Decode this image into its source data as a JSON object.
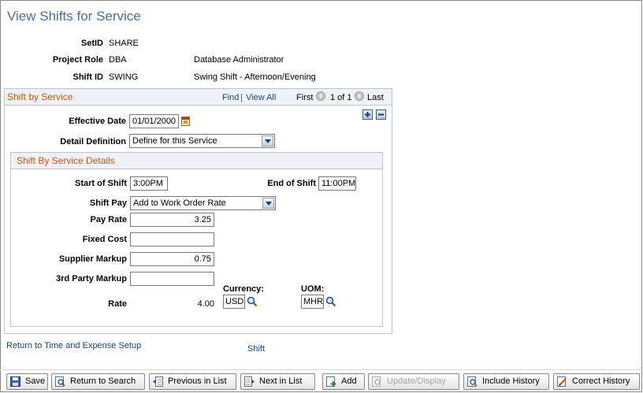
{
  "page": {
    "title": "View Shifts for Service"
  },
  "header": {
    "setid_label": "SetID",
    "setid_value": "SHARE",
    "role_label": "Project Role",
    "role_value": "DBA",
    "role_desc": "Database Administrator",
    "shift_label": "Shift ID",
    "shift_value": "SWING",
    "shift_desc": "Swing Shift - Afternoon/Evening"
  },
  "grid": {
    "title": "Shift by Service",
    "find": "Find",
    "sep": "|",
    "view_all": "View All",
    "first": "First",
    "range": "1 of 1",
    "last": "Last",
    "effective_date_label": "Effective Date",
    "effective_date": "01/01/2000",
    "detail_def_label": "Detail Definition",
    "detail_def_value": "Define for this Service"
  },
  "details": {
    "title": "Shift By Service Details",
    "start_label": "Start of Shift",
    "start_value": "3:00PM",
    "end_label": "End of Shift",
    "end_value": "11:00PM",
    "shift_pay_label": "Shift Pay",
    "shift_pay_value": "Add to Work Order Rate",
    "pay_rate_label": "Pay Rate",
    "pay_rate_value": "3.25",
    "fixed_cost_label": "Fixed Cost",
    "fixed_cost_value": "",
    "supplier_markup_label": "Supplier Markup",
    "supplier_markup_value": "0.75",
    "third_party_label": "3rd Party Markup",
    "third_party_value": "",
    "rate_label": "Rate",
    "rate_value": "4.00",
    "currency_label": "Currency:",
    "currency_value": "USD",
    "uom_label": "UOM:",
    "uom_value": "MHR"
  },
  "links": {
    "return_setup": "Return to Time and Expense Setup",
    "shift": "Shift"
  },
  "toolbar": {
    "save": "Save",
    "return_search": "Return to Search",
    "prev": "Previous in List",
    "next": "Next in List",
    "add": "Add",
    "update": "Update/Display",
    "include_history": "Include History",
    "correct_history": "Correct History"
  },
  "icons": {
    "calendar": "calendar-icon",
    "lookup": "magnifier-icon",
    "add_row": "plus-icon",
    "delete_row": "minus-icon",
    "prev": "left-arrow-icon",
    "next": "right-arrow-icon"
  }
}
